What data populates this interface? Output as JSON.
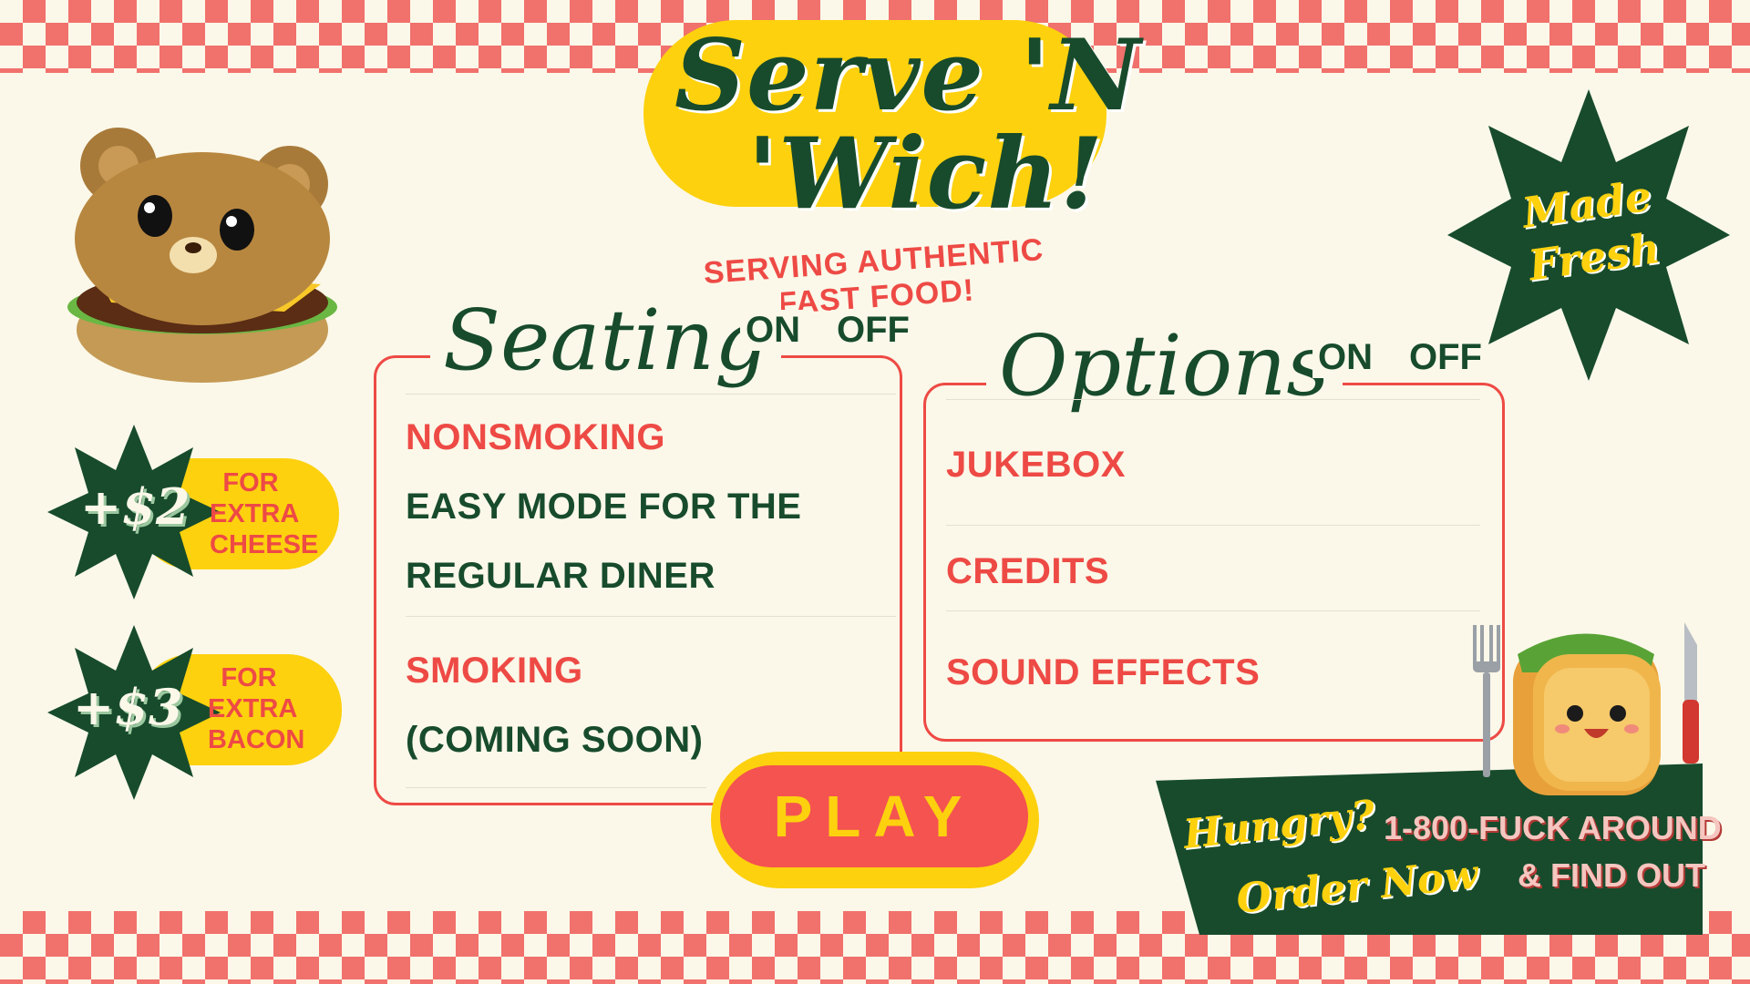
{
  "game": {
    "title_line1": "Serve 'N",
    "title_line2": "'Wich!",
    "tagline": "SERVING AUTHENTIC FAST FOOD!"
  },
  "seating": {
    "heading": "Seating",
    "on_label": "ON",
    "off_label": "OFF",
    "rows": [
      {
        "label": "NONSMOKING",
        "desc_line1": "EASY MODE FOR THE",
        "desc_line2": "REGULAR DINER"
      },
      {
        "label": "SMOKING",
        "desc_line1": "(COMING SOON)"
      }
    ]
  },
  "options": {
    "heading": "Options",
    "on_label": "ON",
    "off_label": "OFF",
    "rows": [
      {
        "label": "JUKEBOX"
      },
      {
        "label": "CREDITS"
      },
      {
        "label": "SOUND EFFECTS"
      }
    ]
  },
  "play_button": "PLAY",
  "badges": [
    {
      "price": "+$2",
      "line1": "FOR",
      "line2": "EXTRA",
      "line3": "CHEESE"
    },
    {
      "price": "+$3",
      "line1": "FOR",
      "line2": "EXTRA",
      "line3": "BACON"
    }
  ],
  "made_fresh": {
    "line1": "Made",
    "line2": "Fresh"
  },
  "promo": {
    "line1": "Hungry?",
    "line2": "Order Now",
    "phone_line1": "1-800-FUCK AROUND",
    "phone_line2": "& FIND OUT"
  },
  "icons": [
    "bear-burger-icon",
    "sandwich-mascot-icon",
    "fork-icon",
    "knife-icon"
  ],
  "colors": {
    "background": "#fbf8e9",
    "checker_red": "#f1716c",
    "dark_green": "#174b2c",
    "accent_red": "#ee4a45",
    "yellow": "#fdd10e"
  }
}
